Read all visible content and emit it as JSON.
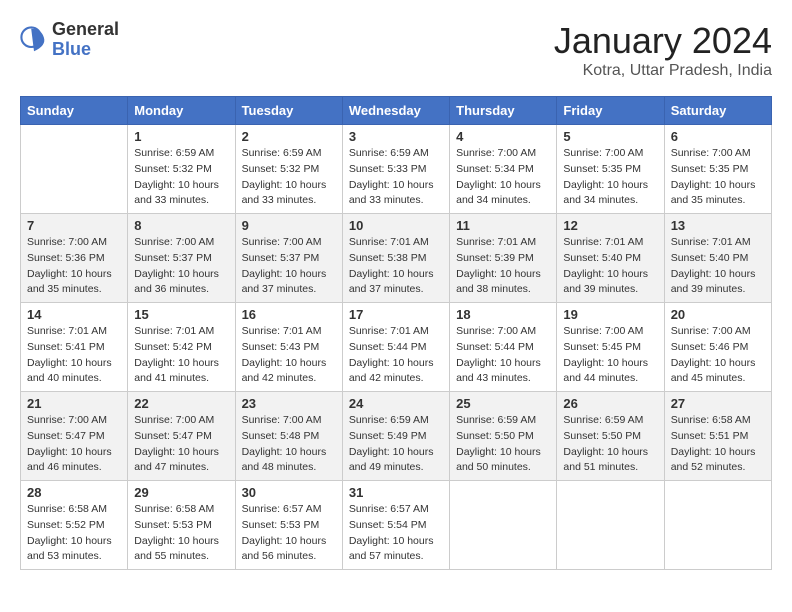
{
  "header": {
    "logo_general": "General",
    "logo_blue": "Blue",
    "month_title": "January 2024",
    "location": "Kotra, Uttar Pradesh, India"
  },
  "days_of_week": [
    "Sunday",
    "Monday",
    "Tuesday",
    "Wednesday",
    "Thursday",
    "Friday",
    "Saturday"
  ],
  "weeks": [
    [
      {
        "num": "",
        "sunrise": "",
        "sunset": "",
        "daylight": ""
      },
      {
        "num": "1",
        "sunrise": "Sunrise: 6:59 AM",
        "sunset": "Sunset: 5:32 PM",
        "daylight": "Daylight: 10 hours and 33 minutes."
      },
      {
        "num": "2",
        "sunrise": "Sunrise: 6:59 AM",
        "sunset": "Sunset: 5:32 PM",
        "daylight": "Daylight: 10 hours and 33 minutes."
      },
      {
        "num": "3",
        "sunrise": "Sunrise: 6:59 AM",
        "sunset": "Sunset: 5:33 PM",
        "daylight": "Daylight: 10 hours and 33 minutes."
      },
      {
        "num": "4",
        "sunrise": "Sunrise: 7:00 AM",
        "sunset": "Sunset: 5:34 PM",
        "daylight": "Daylight: 10 hours and 34 minutes."
      },
      {
        "num": "5",
        "sunrise": "Sunrise: 7:00 AM",
        "sunset": "Sunset: 5:35 PM",
        "daylight": "Daylight: 10 hours and 34 minutes."
      },
      {
        "num": "6",
        "sunrise": "Sunrise: 7:00 AM",
        "sunset": "Sunset: 5:35 PM",
        "daylight": "Daylight: 10 hours and 35 minutes."
      }
    ],
    [
      {
        "num": "7",
        "sunrise": "Sunrise: 7:00 AM",
        "sunset": "Sunset: 5:36 PM",
        "daylight": "Daylight: 10 hours and 35 minutes."
      },
      {
        "num": "8",
        "sunrise": "Sunrise: 7:00 AM",
        "sunset": "Sunset: 5:37 PM",
        "daylight": "Daylight: 10 hours and 36 minutes."
      },
      {
        "num": "9",
        "sunrise": "Sunrise: 7:00 AM",
        "sunset": "Sunset: 5:37 PM",
        "daylight": "Daylight: 10 hours and 37 minutes."
      },
      {
        "num": "10",
        "sunrise": "Sunrise: 7:01 AM",
        "sunset": "Sunset: 5:38 PM",
        "daylight": "Daylight: 10 hours and 37 minutes."
      },
      {
        "num": "11",
        "sunrise": "Sunrise: 7:01 AM",
        "sunset": "Sunset: 5:39 PM",
        "daylight": "Daylight: 10 hours and 38 minutes."
      },
      {
        "num": "12",
        "sunrise": "Sunrise: 7:01 AM",
        "sunset": "Sunset: 5:40 PM",
        "daylight": "Daylight: 10 hours and 39 minutes."
      },
      {
        "num": "13",
        "sunrise": "Sunrise: 7:01 AM",
        "sunset": "Sunset: 5:40 PM",
        "daylight": "Daylight: 10 hours and 39 minutes."
      }
    ],
    [
      {
        "num": "14",
        "sunrise": "Sunrise: 7:01 AM",
        "sunset": "Sunset: 5:41 PM",
        "daylight": "Daylight: 10 hours and 40 minutes."
      },
      {
        "num": "15",
        "sunrise": "Sunrise: 7:01 AM",
        "sunset": "Sunset: 5:42 PM",
        "daylight": "Daylight: 10 hours and 41 minutes."
      },
      {
        "num": "16",
        "sunrise": "Sunrise: 7:01 AM",
        "sunset": "Sunset: 5:43 PM",
        "daylight": "Daylight: 10 hours and 42 minutes."
      },
      {
        "num": "17",
        "sunrise": "Sunrise: 7:01 AM",
        "sunset": "Sunset: 5:44 PM",
        "daylight": "Daylight: 10 hours and 42 minutes."
      },
      {
        "num": "18",
        "sunrise": "Sunrise: 7:00 AM",
        "sunset": "Sunset: 5:44 PM",
        "daylight": "Daylight: 10 hours and 43 minutes."
      },
      {
        "num": "19",
        "sunrise": "Sunrise: 7:00 AM",
        "sunset": "Sunset: 5:45 PM",
        "daylight": "Daylight: 10 hours and 44 minutes."
      },
      {
        "num": "20",
        "sunrise": "Sunrise: 7:00 AM",
        "sunset": "Sunset: 5:46 PM",
        "daylight": "Daylight: 10 hours and 45 minutes."
      }
    ],
    [
      {
        "num": "21",
        "sunrise": "Sunrise: 7:00 AM",
        "sunset": "Sunset: 5:47 PM",
        "daylight": "Daylight: 10 hours and 46 minutes."
      },
      {
        "num": "22",
        "sunrise": "Sunrise: 7:00 AM",
        "sunset": "Sunset: 5:47 PM",
        "daylight": "Daylight: 10 hours and 47 minutes."
      },
      {
        "num": "23",
        "sunrise": "Sunrise: 7:00 AM",
        "sunset": "Sunset: 5:48 PM",
        "daylight": "Daylight: 10 hours and 48 minutes."
      },
      {
        "num": "24",
        "sunrise": "Sunrise: 6:59 AM",
        "sunset": "Sunset: 5:49 PM",
        "daylight": "Daylight: 10 hours and 49 minutes."
      },
      {
        "num": "25",
        "sunrise": "Sunrise: 6:59 AM",
        "sunset": "Sunset: 5:50 PM",
        "daylight": "Daylight: 10 hours and 50 minutes."
      },
      {
        "num": "26",
        "sunrise": "Sunrise: 6:59 AM",
        "sunset": "Sunset: 5:50 PM",
        "daylight": "Daylight: 10 hours and 51 minutes."
      },
      {
        "num": "27",
        "sunrise": "Sunrise: 6:58 AM",
        "sunset": "Sunset: 5:51 PM",
        "daylight": "Daylight: 10 hours and 52 minutes."
      }
    ],
    [
      {
        "num": "28",
        "sunrise": "Sunrise: 6:58 AM",
        "sunset": "Sunset: 5:52 PM",
        "daylight": "Daylight: 10 hours and 53 minutes."
      },
      {
        "num": "29",
        "sunrise": "Sunrise: 6:58 AM",
        "sunset": "Sunset: 5:53 PM",
        "daylight": "Daylight: 10 hours and 55 minutes."
      },
      {
        "num": "30",
        "sunrise": "Sunrise: 6:57 AM",
        "sunset": "Sunset: 5:53 PM",
        "daylight": "Daylight: 10 hours and 56 minutes."
      },
      {
        "num": "31",
        "sunrise": "Sunrise: 6:57 AM",
        "sunset": "Sunset: 5:54 PM",
        "daylight": "Daylight: 10 hours and 57 minutes."
      },
      {
        "num": "",
        "sunrise": "",
        "sunset": "",
        "daylight": ""
      },
      {
        "num": "",
        "sunrise": "",
        "sunset": "",
        "daylight": ""
      },
      {
        "num": "",
        "sunrise": "",
        "sunset": "",
        "daylight": ""
      }
    ]
  ]
}
